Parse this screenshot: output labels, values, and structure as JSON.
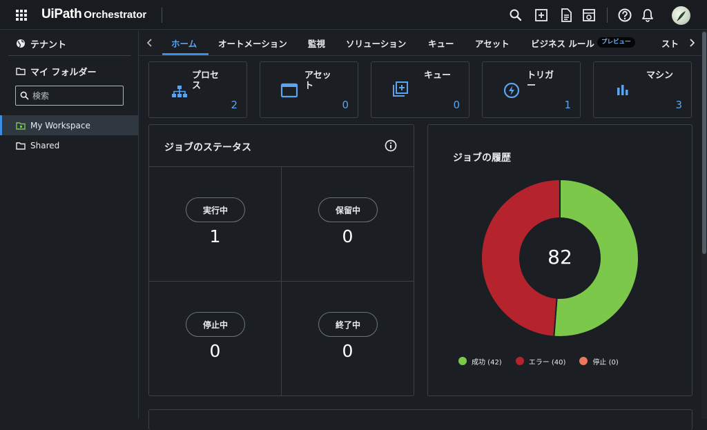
{
  "app": {
    "brand": "UiPath",
    "product": "Orchestrator"
  },
  "topbar": {
    "icons": [
      "apps-grid-icon",
      "search-icon",
      "add-box-icon",
      "document-icon",
      "release-notes-icon",
      "help-icon",
      "bell-icon"
    ]
  },
  "sidebar": {
    "tenant_label": "テナント",
    "my_folders_label": "マイ フォルダー",
    "search_placeholder": "検索",
    "folders": [
      {
        "label": "My Workspace",
        "selected": true
      },
      {
        "label": "Shared",
        "selected": false
      }
    ]
  },
  "tabs": {
    "items": [
      {
        "label": "ホーム",
        "active": true
      },
      {
        "label": "オートメーション"
      },
      {
        "label": "監視"
      },
      {
        "label": "ソリューション"
      },
      {
        "label": "キュー"
      },
      {
        "label": "アセット"
      },
      {
        "label": "ビジネス ルール"
      },
      {
        "label": "スト"
      }
    ],
    "preview_badge": "プレビュー"
  },
  "cards": [
    {
      "label_line1": "プロセ",
      "label_line2": "ス",
      "count": "2",
      "icon": "sitemap-icon"
    },
    {
      "label_line1": "アセッ",
      "label_line2": "ト",
      "count": "0",
      "icon": "asset-window-icon"
    },
    {
      "label_line1": "キュー",
      "label_line2": "",
      "count": "0",
      "icon": "queue-add-icon"
    },
    {
      "label_line1": "トリガ",
      "label_line2": "ー",
      "count": "1",
      "icon": "trigger-bolt-icon"
    },
    {
      "label_line1": "マシン",
      "label_line2": "",
      "count": "3",
      "icon": "machine-chart-icon"
    }
  ],
  "job_status": {
    "title": "ジョブのステータス",
    "cells": [
      {
        "label": "実行中",
        "value": "1"
      },
      {
        "label": "保留中",
        "value": "0"
      },
      {
        "label": "停止中",
        "value": "0"
      },
      {
        "label": "終了中",
        "value": "0"
      }
    ]
  },
  "job_history": {
    "title": "ジョブの履歴",
    "total": "82",
    "legend": [
      {
        "label": "成功 (42)",
        "color": "#7cc84a"
      },
      {
        "label": "エラー (40)",
        "color": "#b5242c"
      },
      {
        "label": "停止 (0)",
        "color": "#e8785e"
      }
    ]
  },
  "chart_data": {
    "type": "pie",
    "donut": true,
    "categories": [
      "成功",
      "エラー",
      "停止"
    ],
    "values": [
      42,
      40,
      0
    ],
    "colors": [
      "#7cc84a",
      "#b5242c",
      "#e8785e"
    ],
    "center_label": "82",
    "title": "ジョブの履歴",
    "legend": "bottom"
  }
}
